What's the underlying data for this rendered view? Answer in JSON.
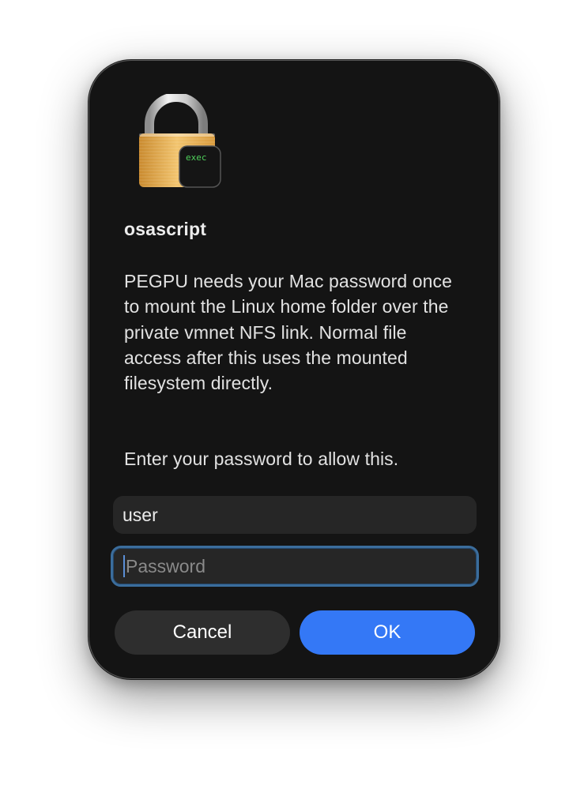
{
  "dialog": {
    "app_name": "osascript",
    "icon_badge": "exec",
    "message": "PEGPU needs your Mac password once to mount the Linux home folder over the private vmnet NFS link. Normal file access after this uses the mounted filesystem directly.",
    "prompt": "Enter your password to allow this.",
    "username_value": "user",
    "password_placeholder": "Password",
    "cancel_label": "Cancel",
    "ok_label": "OK"
  },
  "colors": {
    "dialog_background": "#141414",
    "accent": "#3478f6",
    "focus_ring": "#3b6d9c",
    "badge_text": "#4fd05a"
  },
  "icons": [
    "lock-icon",
    "terminal-exec-badge-icon"
  ]
}
